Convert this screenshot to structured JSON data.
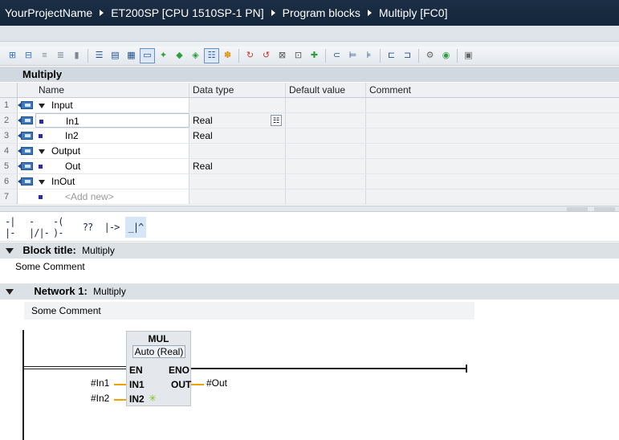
{
  "breadcrumb": [
    "YourProjectName",
    "ET200SP [CPU 1510SP-1 PN]",
    "Program blocks",
    "Multiply [FC0]"
  ],
  "toolbar": {
    "icons": [
      "insert-row-icon",
      "add-row-icon",
      "insert-network-icon",
      "add-network-icon",
      "delete-icon",
      "open-all-networks-icon",
      "close-all-networks-icon",
      "network-list-icon",
      "comments-toggle-icon",
      "favorites-icon",
      "go-to-previous-icon",
      "go-to-next-icon",
      "absolute-operands-icon",
      "assignment-list-icon",
      "call-structure-icon",
      "monitor-on-icon",
      "monitor-off-icon",
      "status-icon",
      "modify-icon",
      "breakpoint-icon",
      "go-to-icon",
      "step-icon",
      "download-icon",
      "compare-icon",
      "settings-icon",
      "database-icon"
    ]
  },
  "block_name": "Multiply",
  "interface": {
    "columns": [
      "Name",
      "Data type",
      "Default value",
      "Comment"
    ],
    "rows": [
      {
        "num": "1",
        "name": "Input",
        "type": "",
        "section": true
      },
      {
        "num": "2",
        "name": "In1",
        "type": "Real",
        "section": false
      },
      {
        "num": "3",
        "name": "In2",
        "type": "Real",
        "section": false
      },
      {
        "num": "4",
        "name": "Output",
        "type": "",
        "section": true
      },
      {
        "num": "5",
        "name": "Out",
        "type": "Real",
        "section": false
      },
      {
        "num": "6",
        "name": "InOut",
        "type": "",
        "section": true
      },
      {
        "num": "7",
        "name": "<Add new>",
        "type": "",
        "section": false
      }
    ]
  },
  "lad_instructions": [
    "-| |-",
    "-|/|-",
    "-( )-",
    "??",
    "|->",
    "_|^"
  ],
  "block_title": {
    "label": "Block title:",
    "value": "Multiply",
    "comment": "Some Comment"
  },
  "network": {
    "label": "Network 1:",
    "value": "Multiply",
    "comment": "Some Comment"
  },
  "mul_box": {
    "name": "MUL",
    "type": "Auto (Real)",
    "pins_in": [
      "EN",
      "IN1",
      "IN2"
    ],
    "pins_out": [
      "ENO",
      "OUT"
    ],
    "operand_in1": "#In1",
    "operand_in2": "#In2",
    "operand_out": "#Out"
  }
}
